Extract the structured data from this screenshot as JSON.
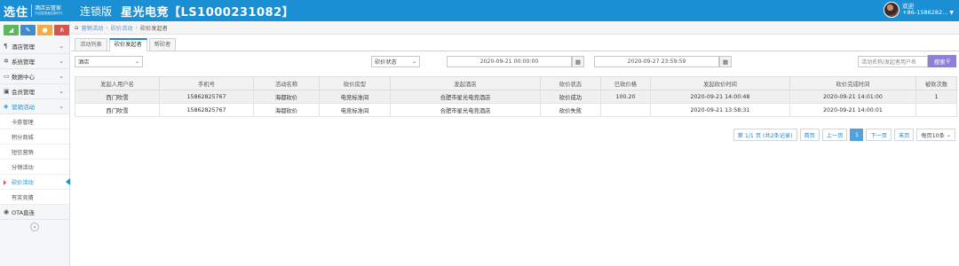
{
  "brand": {
    "logo": "选住",
    "sub1": "酒店云管家",
    "sub2": "开启智慧酒店新时代",
    "edition": "连锁版",
    "store_name": "星光电竞【LS1000231082】"
  },
  "user": {
    "greeting": "欢迎",
    "phone": "+86-1586282..."
  },
  "shortcut_colors": [
    "#5cb85c",
    "#428bca",
    "#f0ad4e",
    "#d9534f"
  ],
  "sidebar": {
    "items": [
      {
        "label": "酒店管理",
        "icon": "hotel-icon"
      },
      {
        "label": "系统管理",
        "icon": "gear-icon"
      },
      {
        "label": "数据中心",
        "icon": "data-icon"
      },
      {
        "label": "会员管理",
        "icon": "member-icon"
      },
      {
        "label": "营销活动",
        "icon": "marketing-icon"
      }
    ],
    "sub_items": [
      "卡券管理",
      "积分商城",
      "短信营销",
      "分销活动",
      "砍价活动",
      "有奖竞猜"
    ],
    "ota": "OTA直连"
  },
  "breadcrumb": [
    "营销活动",
    "砍价活动",
    "砍价发起者"
  ],
  "tabs": [
    "活动列表",
    "砍价发起者",
    "帮砍者"
  ],
  "filters": {
    "hotel": "酒店",
    "status": "砍价状态",
    "start": "2020-09-21 00:00:00",
    "end": "2020-09-27 23:59:59",
    "search_placeholder": "活动名称/发起者用户名",
    "search_btn": "搜索"
  },
  "table": {
    "headers": [
      "发起人用户名",
      "手机号",
      "活动名称",
      "砍价房型",
      "发起酒店",
      "砍价状态",
      "已砍价格",
      "发起砍价时间",
      "砍价完成时间",
      "被砍次数"
    ],
    "rows": [
      [
        "西门吹雪",
        "15862825767",
        "海都砍价",
        "电竞标准间",
        "合肥市星光电竞酒店",
        "砍价成功",
        "100.20",
        "2020-09-21 14:00:48",
        "2020-09-21 14:01:00",
        "1"
      ],
      [
        "西门吹雪",
        "15862825767",
        "海都砍价",
        "电竞标准间",
        "合肥市星光电竞酒店",
        "砍价失败",
        "",
        "2020-09-21 13:58:31",
        "2020-09-21 14:00:01",
        ""
      ]
    ]
  },
  "pager": {
    "info": "第 1/1 页 (共2条记录)",
    "first": "首页",
    "prev": "上一页",
    "current": "1",
    "next": "下一页",
    "last": "末页",
    "per_page": "每页10条"
  }
}
